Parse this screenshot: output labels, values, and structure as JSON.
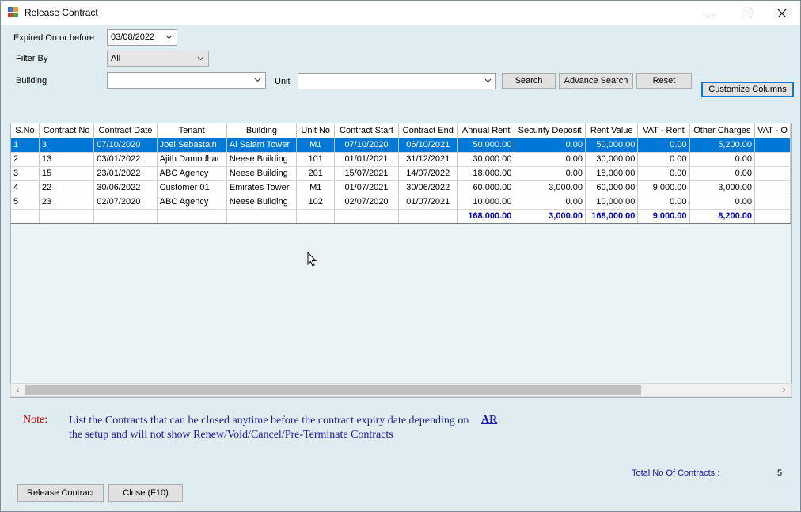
{
  "window": {
    "title": "Release Contract",
    "icon": "app-grid-icon"
  },
  "filters": {
    "expired_label": "Expired On or before",
    "expired_value": "03/08/2022",
    "filter_by_label": "Filter By",
    "filter_by_value": "All",
    "building_label": "Building",
    "building_value": "",
    "unit_label": "Unit",
    "unit_value": ""
  },
  "buttons": {
    "search": "Search",
    "advance_search": "Advance Search",
    "reset": "Reset",
    "customize_columns": "Customize Columns",
    "release_contract": "Release Contract",
    "close": "Close (F10)"
  },
  "table": {
    "columns": [
      "S.No",
      "Contract No",
      "Contract Date",
      "Tenant",
      "Building",
      "Unit No",
      "Contract Start",
      "Contract End",
      "Annual Rent",
      "Security Deposit",
      "Rent Value",
      "VAT - Rent",
      "Other Charges",
      "VAT - O"
    ],
    "rows": [
      [
        "1",
        "3",
        "07/10/2020",
        "Joel Sebastain",
        "Al Salam Tower",
        "M1",
        "07/10/2020",
        "06/10/2021",
        "50,000.00",
        "0.00",
        "50,000.00",
        "0.00",
        "5,200.00",
        ""
      ],
      [
        "2",
        "13",
        "03/01/2022",
        "Ajith Damodhar",
        "Neese Building",
        "101",
        "01/01/2021",
        "31/12/2021",
        "30,000.00",
        "0.00",
        "30,000.00",
        "0.00",
        "0.00",
        ""
      ],
      [
        "3",
        "15",
        "23/01/2022",
        "ABC Agency",
        "Neese Building",
        "201",
        "15/07/2021",
        "14/07/2022",
        "18,000.00",
        "0.00",
        "18,000.00",
        "0.00",
        "0.00",
        ""
      ],
      [
        "4",
        "22",
        "30/06/2022",
        "Customer 01",
        "Emirates Tower",
        "M1",
        "01/07/2021",
        "30/06/2022",
        "60,000.00",
        "3,000.00",
        "60,000.00",
        "9,000.00",
        "3,000.00",
        ""
      ],
      [
        "5",
        "23",
        "02/07/2020",
        "ABC Agency",
        "Neese Building",
        "102",
        "02/07/2020",
        "01/07/2021",
        "10,000.00",
        "0.00",
        "10,000.00",
        "0.00",
        "0.00",
        ""
      ]
    ],
    "selected_row": 0,
    "totals": {
      "annual_rent": "168,000.00",
      "security_deposit": "3,000.00",
      "rent_value": "168,000.00",
      "vat_rent": "9,000.00",
      "other_charges": "8,200.00"
    }
  },
  "note": {
    "label": "Note:",
    "text": "List the Contracts that can be closed anytime before the contract expiry date depending on the setup and will not show Renew/Void/Cancel/Pre-Terminate Contracts",
    "link": "AR"
  },
  "summary": {
    "total_label": "Total No Of Contracts :",
    "total_value": "5"
  },
  "colors": {
    "selection": "#0078d7",
    "note_red": "#cc0000",
    "note_blue": "#1a1aaa",
    "total_blue": "#0000cc"
  }
}
